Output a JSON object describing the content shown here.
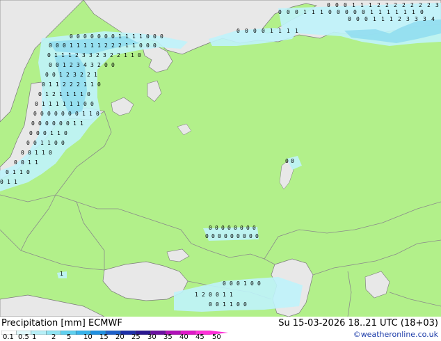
{
  "title": {
    "left_label": "Precipitation [mm]",
    "model": "ECMWF",
    "datetime": "Su 15-03-2026 18..21 UTC (18+03)"
  },
  "credit": "©weatheronline.co.uk",
  "colors": {
    "land": "#b2f08a",
    "sea": "#e8e8e8",
    "border": "#8a8a8a",
    "coast": "#7a7a7a",
    "precip_light": "#bff3fb",
    "precip_mid": "#8fdcf0",
    "precip_heavy": "#4ab8e6"
  },
  "legend": {
    "ticks": [
      "0.1",
      "0.5",
      "1",
      "2",
      "5",
      "10",
      "15",
      "20",
      "25",
      "30",
      "35",
      "40",
      "45",
      "50"
    ],
    "colors": [
      "#ffffff",
      "#dff8fb",
      "#b7eff7",
      "#8fe3f2",
      "#5fcfee",
      "#36b2ea",
      "#1e8fe0",
      "#1c5fc8",
      "#1d2fa8",
      "#2a1690",
      "#6a10a0",
      "#b010b8",
      "#e018c8",
      "#ff30d8"
    ]
  }
}
